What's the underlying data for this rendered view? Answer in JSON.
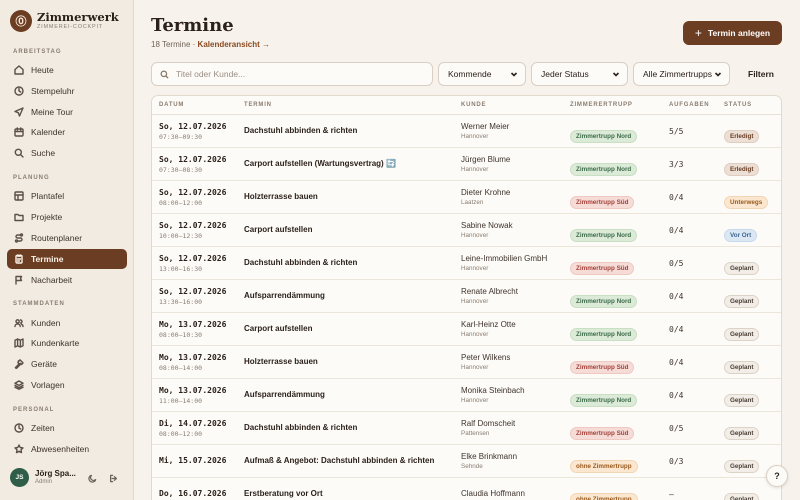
{
  "brand": {
    "logo_glyph": "⓪",
    "name": "Zimmerwerk",
    "subtitle": "ZIMMEREI-COCKPIT"
  },
  "sidebar": {
    "sections": [
      {
        "label": "ARBEITSTAG",
        "items": [
          {
            "label": "Heute",
            "icon": "home-icon"
          },
          {
            "label": "Stempeluhr",
            "icon": "clock-icon"
          },
          {
            "label": "Meine Tour",
            "icon": "send-icon"
          },
          {
            "label": "Kalender",
            "icon": "calendar-icon"
          },
          {
            "label": "Suche",
            "icon": "search-icon"
          }
        ]
      },
      {
        "label": "PLANUNG",
        "items": [
          {
            "label": "Plantafel",
            "icon": "board-icon"
          },
          {
            "label": "Projekte",
            "icon": "folder-icon"
          },
          {
            "label": "Routenplaner",
            "icon": "route-icon"
          },
          {
            "label": "Termine",
            "icon": "clipboard-icon",
            "active": true
          },
          {
            "label": "Nacharbeit",
            "icon": "flag-icon"
          }
        ]
      },
      {
        "label": "STAMMDATEN",
        "items": [
          {
            "label": "Kunden",
            "icon": "users-icon"
          },
          {
            "label": "Kundenkarte",
            "icon": "map-icon"
          },
          {
            "label": "Geräte",
            "icon": "hammer-icon"
          },
          {
            "label": "Vorlagen",
            "icon": "layers-icon"
          }
        ]
      },
      {
        "label": "PERSONAL",
        "items": [
          {
            "label": "Zeiten",
            "icon": "clock-icon"
          },
          {
            "label": "Abwesenheiten",
            "icon": "star-icon"
          }
        ]
      }
    ]
  },
  "user": {
    "initials": "JS",
    "name": "Jörg Spa...",
    "role": "Admin"
  },
  "header": {
    "title": "Termine",
    "count_text": "18 Termine · ",
    "calendar_link": "Kalenderansicht →",
    "create_button": "Termin anlegen",
    "create_glyph": "+"
  },
  "filters": {
    "search_placeholder": "Titel oder Kunde...",
    "period": "Kommende",
    "status": "Jeder Status",
    "team": "Alle Zimmertrupps",
    "filter_button": "Filtern"
  },
  "table": {
    "headers": [
      "DATUM",
      "TERMIN",
      "KUNDE",
      "ZIMMERERTRUPP",
      "AUFGABEN",
      "STATUS"
    ],
    "rows": [
      {
        "date": "So, 12.07.2026",
        "time": "07:30–09:30",
        "title": "Dachstuhl abbinden & richten",
        "customer": "Werner Meier",
        "city": "Hannover",
        "team": "Zimmertrupp Nord",
        "team_class": "b-nord",
        "tasks": "5/5",
        "status": "Erledigt",
        "status_class": "s-erledigt"
      },
      {
        "date": "So, 12.07.2026",
        "time": "07:30–08:30",
        "title": "Carport aufstellen (Wartungsvertrag) 🔄",
        "customer": "Jürgen Blume",
        "city": "Hannover",
        "team": "Zimmertrupp Nord",
        "team_class": "b-nord",
        "tasks": "3/3",
        "status": "Erledigt",
        "status_class": "s-erledigt"
      },
      {
        "date": "So, 12.07.2026",
        "time": "08:00–12:00",
        "title": "Holzterrasse bauen",
        "customer": "Dieter Krohne",
        "city": "Laatzen",
        "team": "Zimmertrupp Süd",
        "team_class": "b-sued",
        "tasks": "0/4",
        "status": "Unterwegs",
        "status_class": "s-unterwegs"
      },
      {
        "date": "So, 12.07.2026",
        "time": "10:00–12:30",
        "title": "Carport aufstellen",
        "customer": "Sabine Nowak",
        "city": "Hannover",
        "team": "Zimmertrupp Nord",
        "team_class": "b-nord",
        "tasks": "0/4",
        "status": "Vor Ort",
        "status_class": "s-vorort"
      },
      {
        "date": "So, 12.07.2026",
        "time": "13:00–16:30",
        "title": "Dachstuhl abbinden & richten",
        "customer": "Leine-Immobilien GmbH",
        "city": "Hannover",
        "team": "Zimmertrupp Süd",
        "team_class": "b-sued",
        "tasks": "0/5",
        "status": "Geplant",
        "status_class": "s-geplant"
      },
      {
        "date": "So, 12.07.2026",
        "time": "13:30–16:00",
        "title": "Aufsparrendämmung",
        "customer": "Renate Albrecht",
        "city": "Hannover",
        "team": "Zimmertrupp Nord",
        "team_class": "b-nord",
        "tasks": "0/4",
        "status": "Geplant",
        "status_class": "s-geplant"
      },
      {
        "date": "Mo, 13.07.2026",
        "time": "08:00–10:30",
        "title": "Carport aufstellen",
        "customer": "Karl-Heinz Otte",
        "city": "Hannover",
        "team": "Zimmertrupp Nord",
        "team_class": "b-nord",
        "tasks": "0/4",
        "status": "Geplant",
        "status_class": "s-geplant"
      },
      {
        "date": "Mo, 13.07.2026",
        "time": "08:00–14:00",
        "title": "Holzterrasse bauen",
        "customer": "Peter Wilkens",
        "city": "Hannover",
        "team": "Zimmertrupp Süd",
        "team_class": "b-sued",
        "tasks": "0/4",
        "status": "Geplant",
        "status_class": "s-geplant"
      },
      {
        "date": "Mo, 13.07.2026",
        "time": "11:00–14:00",
        "title": "Aufsparrendämmung",
        "customer": "Monika Steinbach",
        "city": "Hannover",
        "team": "Zimmertrupp Nord",
        "team_class": "b-nord",
        "tasks": "0/4",
        "status": "Geplant",
        "status_class": "s-geplant"
      },
      {
        "date": "Di, 14.07.2026",
        "time": "08:00–12:00",
        "title": "Dachstuhl abbinden & richten",
        "customer": "Ralf Domscheit",
        "city": "Pattensen",
        "team": "Zimmertrupp Süd",
        "team_class": "b-sued",
        "tasks": "0/5",
        "status": "Geplant",
        "status_class": "s-geplant"
      },
      {
        "date": "Mi, 15.07.2026",
        "time": "",
        "title": "Aufmaß & Angebot: Dachstuhl abbinden & richten",
        "customer": "Elke Brinkmann",
        "city": "Sehnde",
        "team": "ohne Zimmertrupp",
        "team_class": "b-ohne",
        "tasks": "0/3",
        "status": "Geplant",
        "status_class": "s-geplant"
      },
      {
        "date": "Do, 16.07.2026",
        "time": "",
        "title": "Erstberatung vor Ort",
        "customer": "Claudia Hoffmann",
        "city": "",
        "team": "ohne Zimmertrupp",
        "team_class": "b-ohne",
        "tasks": "–",
        "status": "Geplant",
        "status_class": "s-geplant"
      }
    ]
  },
  "help": {
    "label": "?"
  }
}
